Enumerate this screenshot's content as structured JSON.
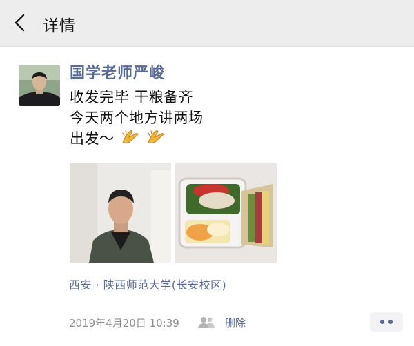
{
  "header": {
    "back_icon": "chevron-left-icon",
    "title": "详情"
  },
  "post": {
    "author": "国学老师严峻",
    "lines": [
      "收发完毕 干粮备齐",
      "今天两个地方讲两场",
      "出发～"
    ],
    "emoji": "clap-hands-icon",
    "location": "西安 · 陕西师范大学(长安校区)",
    "timestamp": "2019年4月20日 10:39",
    "visibility_icon": "friends-visibility-icon",
    "delete_label": "删除",
    "more_icon": "more-dots-icon"
  },
  "colors": {
    "link": "#576b95",
    "header_bg": "#ededed",
    "meta": "#8c8c8c"
  }
}
